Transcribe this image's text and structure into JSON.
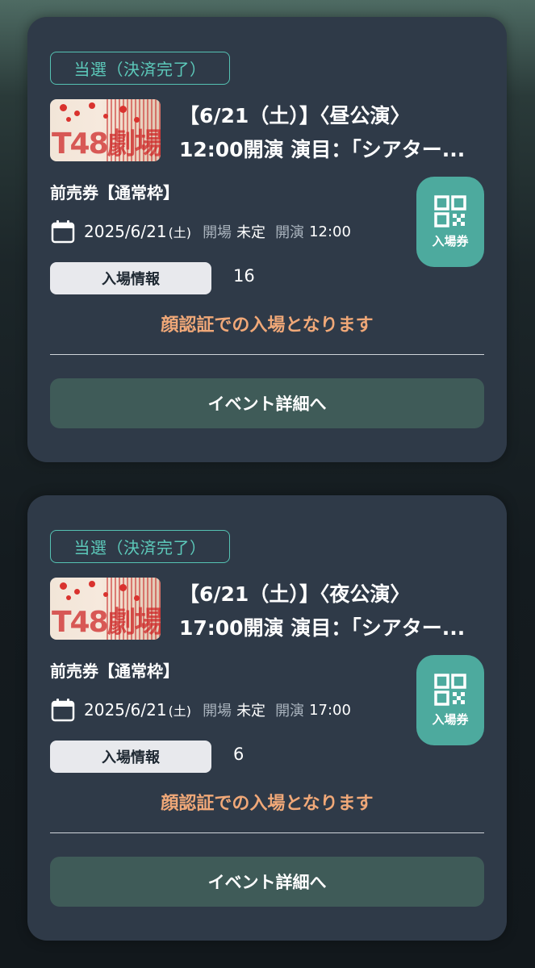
{
  "tickets": [
    {
      "status": "当選（決済完了）",
      "thumbnail_text": "T48劇場",
      "title_line1": "【6/21（土）】〈昼公演〉",
      "title_line2": "12:00開演 演目：「シアター...",
      "ticket_type": "前売券【通常枠】",
      "date": "2025/6/21",
      "weekday": "(土)",
      "doors_label": "開場",
      "doors_value": "未定",
      "start_label": "開演",
      "start_value": "12:00",
      "entry_info_label": "入場情報",
      "entry_number": "16",
      "qr_label": "入場券",
      "notice": "顔認証での入場となります",
      "detail_label": "イベント詳細へ"
    },
    {
      "status": "当選（決済完了）",
      "thumbnail_text": "T48劇場",
      "title_line1": "【6/21（土）】〈夜公演〉",
      "title_line2": "17:00開演 演目：「シアター...",
      "ticket_type": "前売券【通常枠】",
      "date": "2025/6/21",
      "weekday": "(土)",
      "doors_label": "開場",
      "doors_value": "未定",
      "start_label": "開演",
      "start_value": "17:00",
      "entry_info_label": "入場情報",
      "entry_number": "6",
      "qr_label": "入場券",
      "notice": "顔認証での入場となります",
      "detail_label": "イベント詳細へ"
    }
  ],
  "colors": {
    "card_bg": "#2f3a48",
    "accent_teal": "#4daa9e",
    "badge_teal": "#55c2b3",
    "notice_orange": "#f0a878",
    "detail_button": "#3f5b58"
  },
  "icons": {
    "qr": "qr-code-icon",
    "calendar": "calendar-icon"
  }
}
